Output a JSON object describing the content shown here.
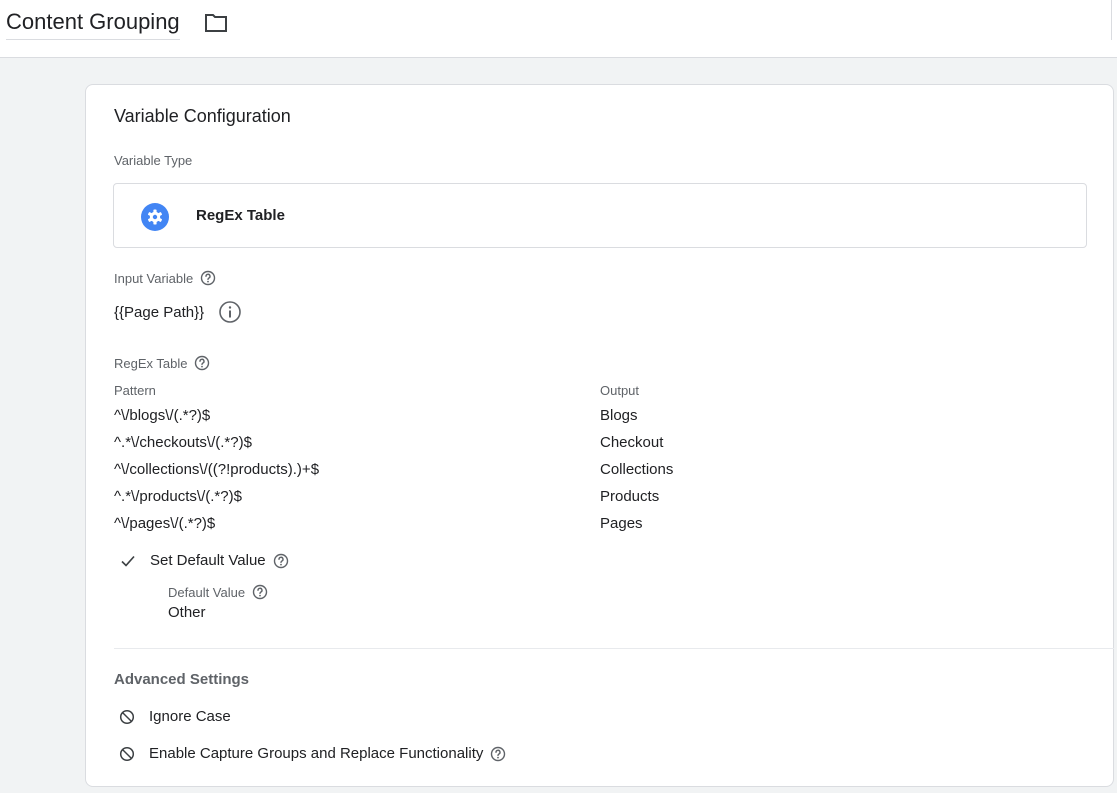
{
  "header": {
    "title": "Content Grouping",
    "folder_icon": "folder-icon"
  },
  "config": {
    "title": "Variable Configuration",
    "variable_type_label": "Variable Type",
    "variable_type": "RegEx Table",
    "variable_type_icon": "gear-icon",
    "accent_color": "#4285f4",
    "input_variable_label": "Input Variable",
    "input_variable_value": "{{Page Path}}",
    "regex_table_label": "RegEx Table",
    "columns": {
      "pattern": "Pattern",
      "output": "Output"
    },
    "rows": [
      {
        "pattern": "^\\/blogs\\/(.*?)$",
        "output": "Blogs"
      },
      {
        "pattern": "^.*\\/checkouts\\/(.*?)$",
        "output": "Checkout"
      },
      {
        "pattern": "^\\/collections\\/((?!products).)+$",
        "output": "Collections"
      },
      {
        "pattern": "^.*\\/products\\/(.*?)$",
        "output": "Products"
      },
      {
        "pattern": "^\\/pages\\/(.*?)$",
        "output": "Pages"
      }
    ],
    "set_default_label": "Set Default Value",
    "default_value_label": "Default Value",
    "default_value": "Other"
  },
  "advanced": {
    "title": "Advanced Settings",
    "ignore_case": "Ignore Case",
    "capture_groups": "Enable Capture Groups and Replace Functionality"
  }
}
